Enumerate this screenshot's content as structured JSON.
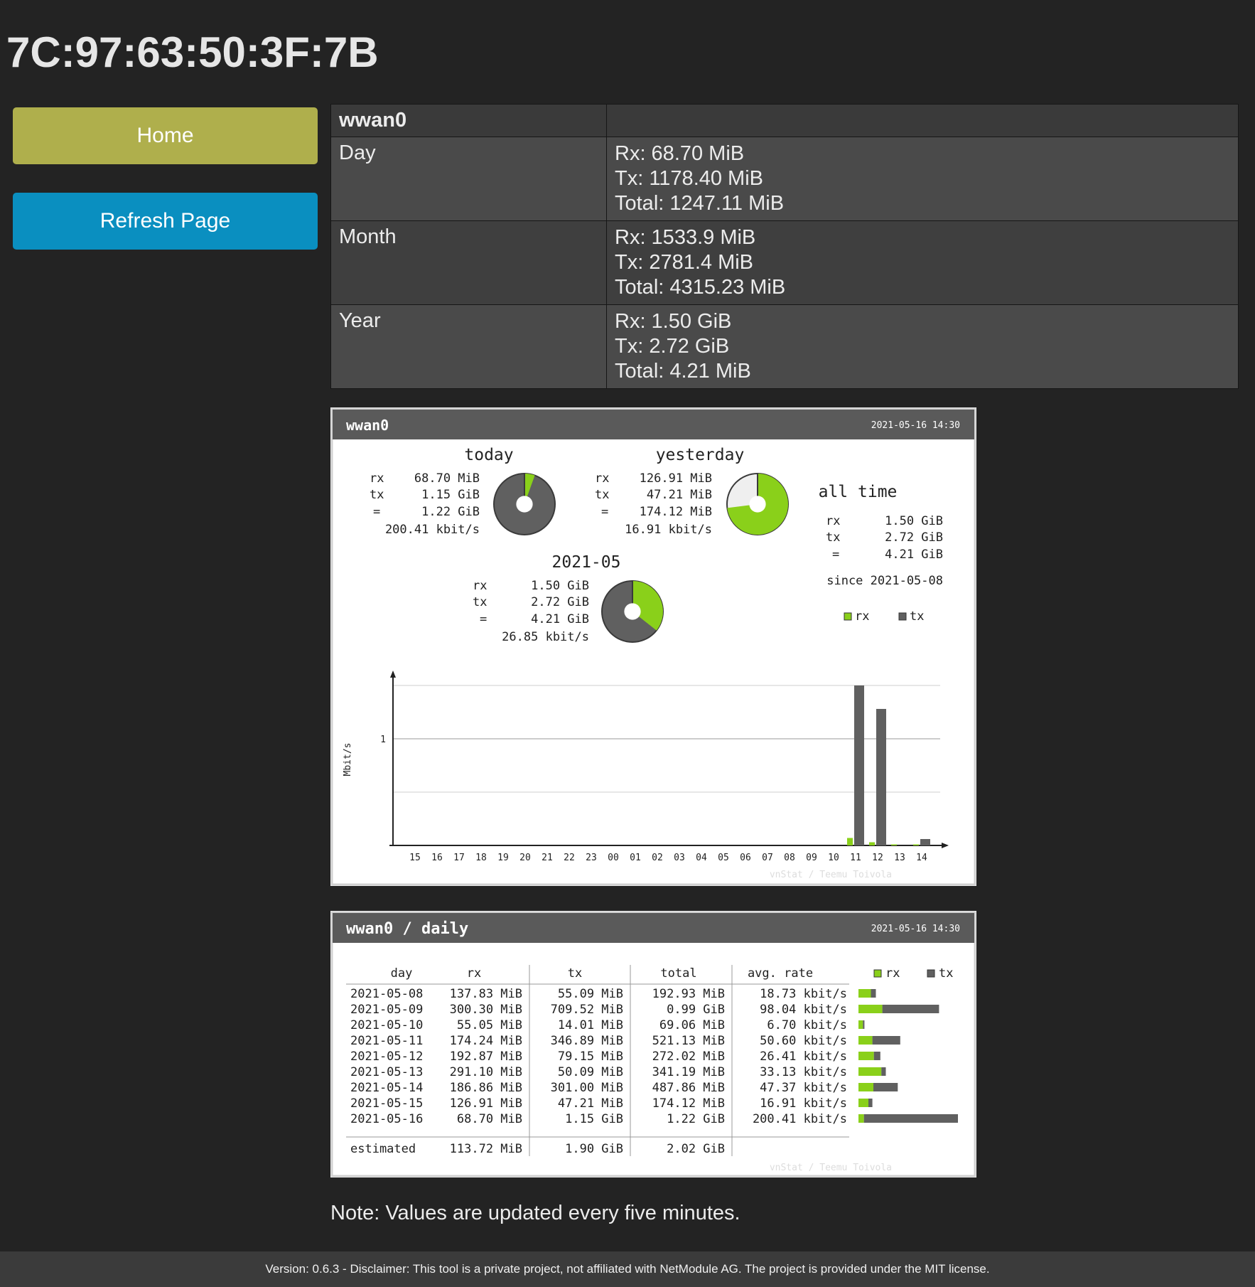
{
  "page": {
    "title": "7C:97:63:50:3F:7B",
    "note": "Note: Values are updated every five minutes.",
    "footer": "Version: 0.6.3 - Disclaimer: This tool is a private project, not affiliated with NetModule AG. The project is provided under the MIT license."
  },
  "nav": {
    "home_label": "Home",
    "refresh_label": "Refresh Page"
  },
  "colors": {
    "home_button": "#afaf4c",
    "refresh_button": "#0a8fc0",
    "rx": "#8ad01a",
    "tx": "#606060"
  },
  "traffic": {
    "interface": "wwan0",
    "rows": [
      {
        "period": "Day",
        "rx": "Rx: 68.70 MiB",
        "tx": "Tx: 1178.40 MiB",
        "total": "Total: 1247.11 MiB"
      },
      {
        "period": "Month",
        "rx": "Rx: 1533.9 MiB",
        "tx": "Tx: 2781.4 MiB",
        "total": "Total: 4315.23 MiB"
      },
      {
        "period": "Year",
        "rx": "Rx: 1.50 GiB",
        "tx": "Tx: 2.72 GiB",
        "total": "Total: 4.21 MiB"
      }
    ]
  },
  "summary": {
    "interface": "wwan0",
    "timestamp": "2021-05-16 14:30",
    "today": {
      "title": "today",
      "rx": "68.70 MiB",
      "tx": "1.15 GiB",
      "total": "1.22 GiB",
      "rate": "200.41 kbit/s",
      "rx_share": 0.055
    },
    "yesterday": {
      "title": "yesterday",
      "rx": "126.91 MiB",
      "tx": "47.21 MiB",
      "total": "174.12 MiB",
      "rate": "16.91 kbit/s",
      "rx_share": 0.73
    },
    "month": {
      "title": "2021-05",
      "rx": "1.50 GiB",
      "tx": "2.72 GiB",
      "total": "4.21 GiB",
      "rate": "26.85 kbit/s",
      "rx_share": 0.356
    },
    "all_time": {
      "title": "all  time",
      "rx": "1.50 GiB",
      "tx": "2.72 GiB",
      "total": "4.21 GiB",
      "since": "since 2021-05-08"
    },
    "labels": {
      "rx": "rx",
      "tx": "tx",
      "eq": "="
    },
    "legend": {
      "rx": "rx",
      "tx": "tx"
    },
    "credit": "vnStat / Teemu Toivola"
  },
  "chart_data": {
    "type": "bar",
    "title": "",
    "ylabel": "Mbit/s",
    "xlabel": "",
    "ylim": [
      0,
      1.5
    ],
    "yticks": [
      1
    ],
    "categories": [
      "15",
      "16",
      "17",
      "18",
      "19",
      "20",
      "21",
      "22",
      "23",
      "00",
      "01",
      "02",
      "03",
      "04",
      "05",
      "06",
      "07",
      "08",
      "09",
      "10",
      "11",
      "12",
      "13",
      "14"
    ],
    "series": [
      {
        "name": "rx",
        "values": [
          0,
          0,
          0,
          0,
          0,
          0,
          0,
          0,
          0,
          0,
          0,
          0,
          0,
          0,
          0,
          0,
          0,
          0,
          0,
          0,
          0.07,
          0.03,
          0.01,
          0.01
        ]
      },
      {
        "name": "tx",
        "values": [
          0,
          0,
          0,
          0,
          0,
          0,
          0,
          0,
          0,
          0,
          0,
          0,
          0,
          0,
          0,
          0,
          0,
          0,
          0,
          0,
          1.5,
          1.28,
          0,
          0.06
        ]
      }
    ]
  },
  "daily": {
    "title": "wwan0 / daily",
    "timestamp": "2021-05-16 14:30",
    "headers": {
      "day": "day",
      "rx": "rx",
      "tx": "tx",
      "total": "total",
      "rate": "avg. rate"
    },
    "legend": {
      "rx": "rx",
      "tx": "tx"
    },
    "rows": [
      {
        "day": "2021-05-08",
        "rx": "137.83 MiB",
        "tx": "55.09 MiB",
        "total": "192.93 MiB",
        "rate": "18.73 kbit/s",
        "rx_frac": 0.125,
        "tx_frac": 0.05
      },
      {
        "day": "2021-05-09",
        "rx": "300.30 MiB",
        "tx": "709.52 MiB",
        "total": "0.99 GiB",
        "rate": "98.04 kbit/s",
        "rx_frac": 0.24,
        "tx_frac": 0.57
      },
      {
        "day": "2021-05-10",
        "rx": "55.05 MiB",
        "tx": "14.01 MiB",
        "total": "69.06 MiB",
        "rate": "6.70 kbit/s",
        "rx_frac": 0.045,
        "tx_frac": 0.015
      },
      {
        "day": "2021-05-11",
        "rx": "174.24 MiB",
        "tx": "346.89 MiB",
        "total": "521.13 MiB",
        "rate": "50.60 kbit/s",
        "rx_frac": 0.14,
        "tx_frac": 0.28
      },
      {
        "day": "2021-05-12",
        "rx": "192.87 MiB",
        "tx": "79.15 MiB",
        "total": "272.02 MiB",
        "rate": "26.41 kbit/s",
        "rx_frac": 0.155,
        "tx_frac": 0.065
      },
      {
        "day": "2021-05-13",
        "rx": "291.10 MiB",
        "tx": "50.09 MiB",
        "total": "341.19 MiB",
        "rate": "33.13 kbit/s",
        "rx_frac": 0.23,
        "tx_frac": 0.045
      },
      {
        "day": "2021-05-14",
        "rx": "186.86 MiB",
        "tx": "301.00 MiB",
        "total": "487.86 MiB",
        "rate": "47.37 kbit/s",
        "rx_frac": 0.15,
        "tx_frac": 0.245
      },
      {
        "day": "2021-05-15",
        "rx": "126.91 MiB",
        "tx": "47.21 MiB",
        "total": "174.12 MiB",
        "rate": "16.91 kbit/s",
        "rx_frac": 0.1,
        "tx_frac": 0.04
      },
      {
        "day": "2021-05-16",
        "rx": "68.70 MiB",
        "tx": "1.15 GiB",
        "total": "1.22 GiB",
        "rate": "200.41 kbit/s",
        "rx_frac": 0.055,
        "tx_frac": 0.945
      }
    ],
    "estimated": {
      "label": "estimated",
      "rx": "113.72 MiB",
      "tx": "1.90 GiB",
      "total": "2.02 GiB"
    },
    "credit": "vnStat / Teemu Toivola"
  }
}
